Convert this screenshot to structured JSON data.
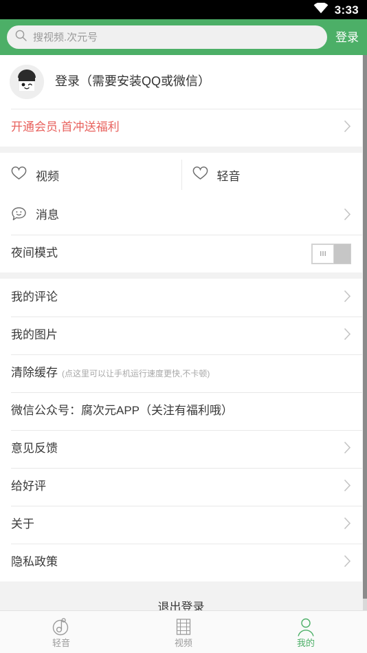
{
  "statusbar": {
    "time": "3:33",
    "wifi_icon": "wifi-icon"
  },
  "header": {
    "search": {
      "placeholder": "搜视频.次元号",
      "value": "",
      "icon": "search-icon"
    },
    "login_label": "登录"
  },
  "profile": {
    "avatar_icon": "avatar-face-icon",
    "login_text": "登录（需要安装QQ或微信）"
  },
  "vip": {
    "label": "开通会员,首冲送福利",
    "color": "#e8625e",
    "chevron_icon": "chevron-right-icon"
  },
  "favorites": [
    {
      "label": "视频",
      "icon": "heart-icon"
    },
    {
      "label": "轻音",
      "icon": "heart-icon"
    }
  ],
  "message": {
    "label": "消息",
    "icon": "message-smiley-icon",
    "chevron_icon": "chevron-right-icon"
  },
  "night_mode": {
    "label": "夜间模式",
    "toggle_state": "off",
    "toggle_icon": "toggle-switch"
  },
  "settings": [
    {
      "label": "我的评论",
      "sub": "",
      "chevron": true
    },
    {
      "label": "我的图片",
      "sub": "",
      "chevron": true
    },
    {
      "label": "清除缓存",
      "sub": "(点这里可以让手机运行速度更快,不卡顿)",
      "chevron": false
    },
    {
      "label": "微信公众号：腐次元APP（关注有福利哦）",
      "sub": "",
      "chevron": false
    },
    {
      "label": "意见反馈",
      "sub": "",
      "chevron": true
    },
    {
      "label": "给好评",
      "sub": "",
      "chevron": true
    },
    {
      "label": "关于",
      "sub": "",
      "chevron": true
    },
    {
      "label": "隐私政策",
      "sub": "",
      "chevron": true
    }
  ],
  "logout": {
    "label": "退出登录"
  },
  "tabbar": {
    "accent_color": "#4caf67",
    "inactive_color": "#9b9b9b",
    "tabs": [
      {
        "label": "轻音",
        "icon": "music-note-circle-icon",
        "active": false
      },
      {
        "label": "视频",
        "icon": "film-strip-icon",
        "active": false
      },
      {
        "label": "我的",
        "icon": "person-icon",
        "active": true
      }
    ]
  }
}
